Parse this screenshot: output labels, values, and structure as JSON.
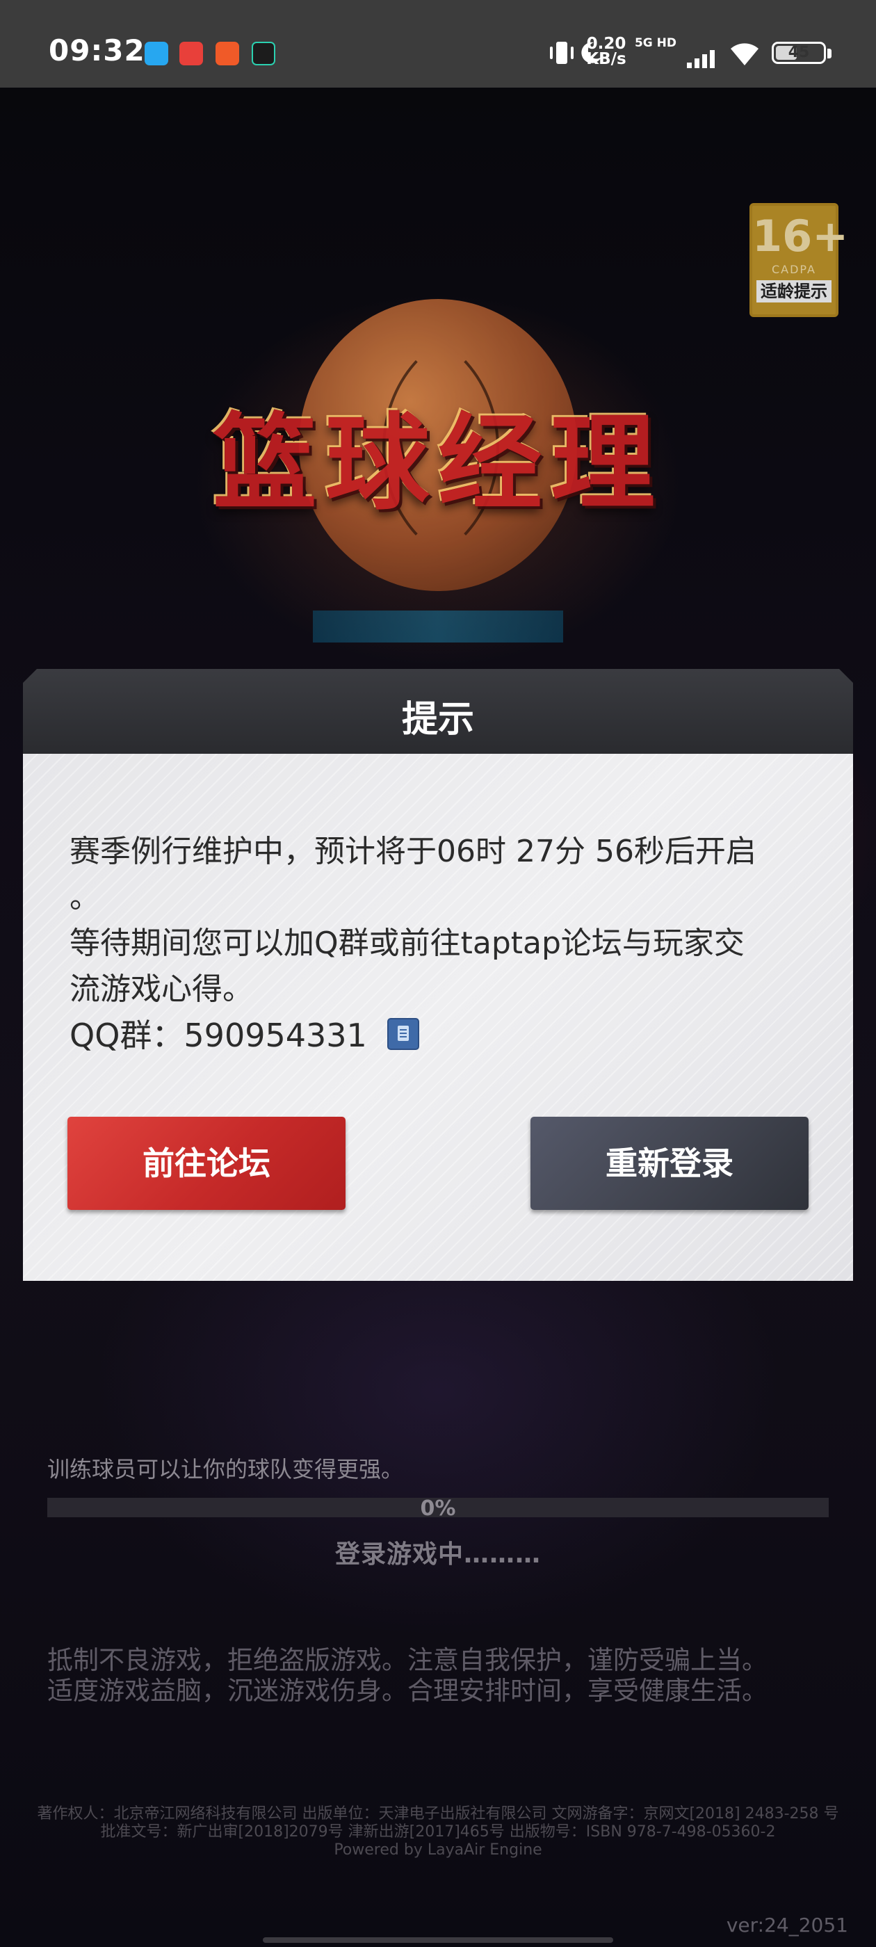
{
  "status_bar": {
    "time": "09:32",
    "app_icons": [
      {
        "name": "blue-app-icon",
        "color": "#27a7f0"
      },
      {
        "name": "red-shopping-app-icon",
        "color": "#e8403a"
      },
      {
        "name": "orange-app-icon",
        "color": "#f05a28"
      },
      {
        "name": "dark-video-app-icon",
        "color": "#1c1c1c"
      }
    ],
    "net_speed_value": "0.20",
    "net_speed_unit": "KB/s",
    "signal_label": "5G HD",
    "battery_level": "45"
  },
  "age_rating": {
    "age": "16+",
    "org": "CADPA",
    "tip": "适龄提示"
  },
  "game_logo": {
    "title": "篮球经理"
  },
  "dialog": {
    "title": "提示",
    "message_line1": "赛季例行维护中，预计将于06时 27分 56秒后开启",
    "message_line2": "。",
    "message_line3": "等待期间您可以加Q群或前往taptap论坛与玩家交",
    "message_line4": "流游戏心得。",
    "qq_group": "QQ群：590954331",
    "forum_button": "前往论坛",
    "relogin_button": "重新登录"
  },
  "loading": {
    "tip": "训练球员可以让你的球队变得更强。",
    "progress_percent": 0,
    "progress_text": "0%",
    "status": "登录游戏中………"
  },
  "health_notice": {
    "line1": "抵制不良游戏，拒绝盗版游戏。注意自我保护，谨防受骗上当。",
    "line2": "适度游戏益脑，沉迷游戏伤身。合理安排时间，享受健康生活。"
  },
  "credits": {
    "line1": "著作权人：北京帝江网络科技有限公司 出版单位：天津电子出版社有限公司 文网游备字：京网文[2018] 2483-258 号",
    "line2": "批准文号：新广出审[2018]2079号    津新出游[2017]465号    出版物号：ISBN 978-7-498-05360-2",
    "line3": "Powered by LayaAir Engine"
  },
  "version": "ver:24_2051"
}
